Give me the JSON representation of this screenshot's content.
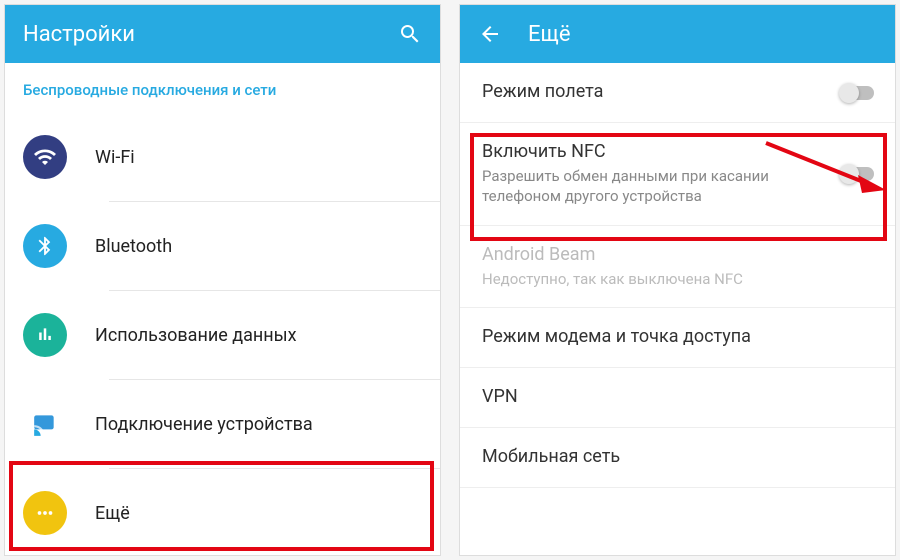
{
  "left": {
    "title": "Настройки",
    "sectionHeader": "Беспроводные подключения и сети",
    "items": [
      {
        "label": "Wi-Fi"
      },
      {
        "label": "Bluetooth"
      },
      {
        "label": "Использование данных"
      },
      {
        "label": "Подключение устройства"
      },
      {
        "label": "Ещё"
      }
    ]
  },
  "right": {
    "title": "Ещё",
    "items": [
      {
        "label": "Режим полета",
        "toggle": true
      },
      {
        "label": "Включить NFC",
        "sublabel": "Разрешить обмен данными при касании телефоном другого устройства",
        "toggle": true
      },
      {
        "label": "Android Beam",
        "sublabel": "Недоступно, так как выключена NFC",
        "disabled": true
      },
      {
        "label": "Режим модема и точка доступа"
      },
      {
        "label": "VPN"
      },
      {
        "label": "Мобильная сеть"
      }
    ]
  },
  "colors": {
    "accent": "#27aae1",
    "highlight": "#e30613"
  }
}
